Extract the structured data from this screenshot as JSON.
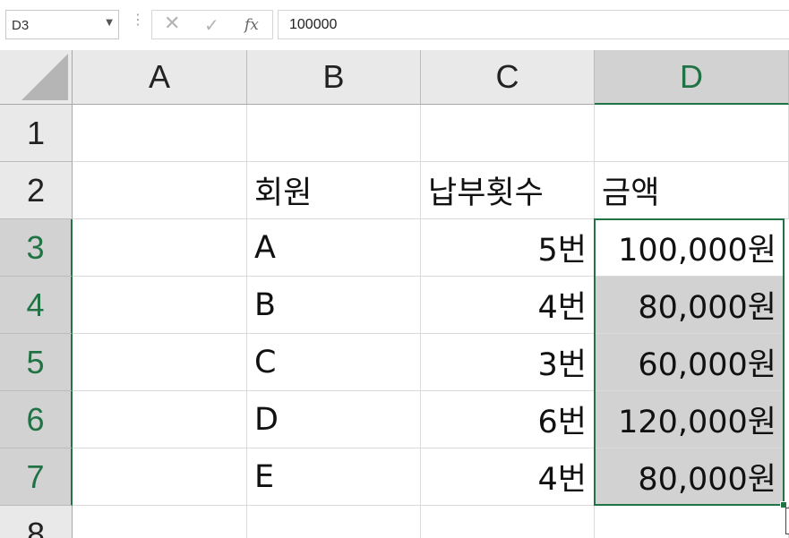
{
  "name_box": {
    "value": "D3"
  },
  "formula_bar": {
    "value": "100000",
    "function_label": "fx"
  },
  "columns": [
    "A",
    "B",
    "C",
    "D"
  ],
  "rows": [
    "1",
    "2",
    "3",
    "4",
    "5",
    "6",
    "7",
    "8"
  ],
  "cells": {
    "B2": "회원",
    "C2": "납부횟수",
    "D2": "금액",
    "B3": "A",
    "C3": "5번",
    "D3": "100,000원",
    "B4": "B",
    "C4": "4번",
    "D4": "80,000원",
    "B5": "C",
    "C5": "3번",
    "D5": "60,000원",
    "B6": "D",
    "C6": "6번",
    "D6": "120,000원",
    "B7": "E",
    "C7": "4번",
    "D7": "80,000원"
  },
  "selection": {
    "active_cell": "D3",
    "range": "D3:D7"
  },
  "colors": {
    "accent": "#217346",
    "header_bg": "#e9e9e9",
    "selected_bg": "#d2d2d2"
  }
}
